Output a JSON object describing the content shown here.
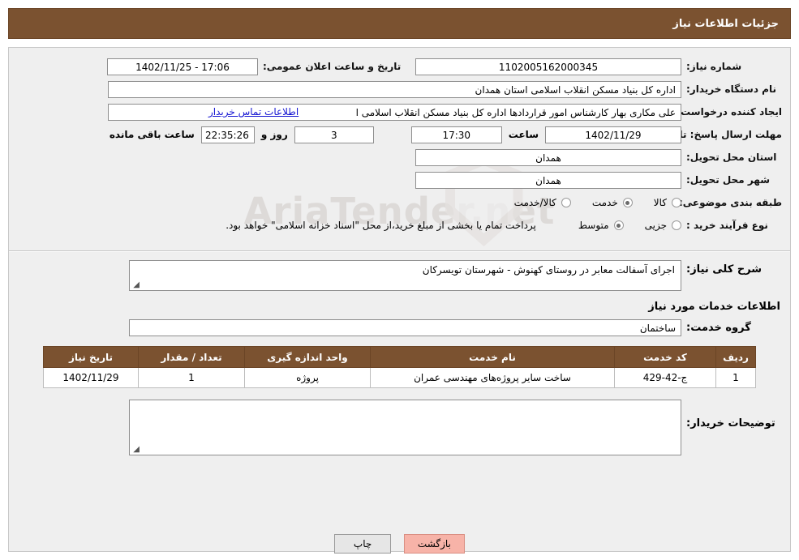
{
  "header": {
    "title": "جزئیات اطلاعات نیاز"
  },
  "watermark": {
    "text": "AriaTender.net"
  },
  "form": {
    "need_number_label": "شماره نیاز:",
    "need_number_value": "1102005162000345",
    "announce_datetime_label": "تاریخ و ساعت اعلان عمومی:",
    "announce_datetime_value": "17:06 - 1402/11/25",
    "buyer_org_label": "نام دستگاه خریدار:",
    "buyer_org_value": "اداره کل بنیاد مسکن انقلاب اسلامی استان همدان",
    "requester_label": "ایجاد کننده درخواست:",
    "requester_value": "علی مکاری بهار کارشناس امور قراردادها اداره کل بنیاد مسکن انقلاب اسلامی ا",
    "buyer_contact_link": "اطلاعات تماس خریدار",
    "deadline_label": "مهلت ارسال پاسخ: تا تاریخ:",
    "deadline_date": "1402/11/29",
    "hour_label": "ساعت",
    "deadline_time": "17:30",
    "days_value": "3",
    "days_label": "روز و",
    "countdown_value": "22:35:26",
    "remaining_label": "ساعت باقی مانده",
    "province_label": "استان محل تحویل:",
    "province_value": "همدان",
    "city_label": "شهر محل تحویل:",
    "city_value": "همدان",
    "category_label": "طبقه بندی موضوعی:",
    "category_options": [
      {
        "label": "کالا",
        "checked": false
      },
      {
        "label": "خدمت",
        "checked": true
      },
      {
        "label": "کالا/خدمت",
        "checked": false
      }
    ],
    "process_label": "نوع فرآیند خرید :",
    "process_options": [
      {
        "label": "جزیی",
        "checked": false
      },
      {
        "label": "متوسط",
        "checked": true
      }
    ],
    "process_note": "پرداخت تمام یا بخشی از مبلغ خرید،از محل \"اسناد خزانه اسلامی\" خواهد بود."
  },
  "general_desc": {
    "label": "شرح کلی نیاز:",
    "value": "اجرای آسفالت معابر در روستای کهنوش - شهرستان تویسرکان"
  },
  "services": {
    "section_title": "اطلاعات خدمات مورد نیاز",
    "group_label": "گروه خدمت:",
    "group_value": "ساختمان",
    "columns": [
      "ردیف",
      "کد خدمت",
      "نام خدمت",
      "واحد اندازه گیری",
      "تعداد / مقدار",
      "تاریخ نیاز"
    ],
    "rows": [
      {
        "index": "1",
        "code": "ج-42-429",
        "name": "ساخت سایر پروژه‌های مهندسی عمران",
        "unit": "پروژه",
        "quantity": "1",
        "date": "1402/11/29"
      }
    ]
  },
  "buyer_notes": {
    "label": "توضیحات خریدار:",
    "value": ""
  },
  "buttons": {
    "print": "چاپ",
    "back": "بازگشت"
  }
}
